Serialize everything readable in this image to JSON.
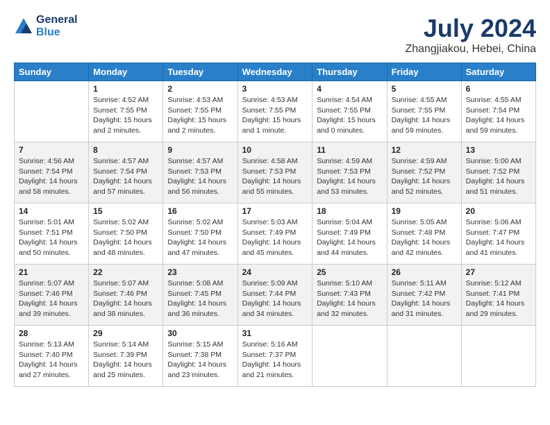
{
  "header": {
    "logo_line1": "General",
    "logo_line2": "Blue",
    "title": "July 2024",
    "subtitle": "Zhangjiakou, Hebei, China"
  },
  "days_of_week": [
    "Sunday",
    "Monday",
    "Tuesday",
    "Wednesday",
    "Thursday",
    "Friday",
    "Saturday"
  ],
  "weeks": [
    [
      {
        "day": "",
        "info": ""
      },
      {
        "day": "1",
        "info": "Sunrise: 4:52 AM\nSunset: 7:55 PM\nDaylight: 15 hours\nand 2 minutes."
      },
      {
        "day": "2",
        "info": "Sunrise: 4:53 AM\nSunset: 7:55 PM\nDaylight: 15 hours\nand 2 minutes."
      },
      {
        "day": "3",
        "info": "Sunrise: 4:53 AM\nSunset: 7:55 PM\nDaylight: 15 hours\nand 1 minute."
      },
      {
        "day": "4",
        "info": "Sunrise: 4:54 AM\nSunset: 7:55 PM\nDaylight: 15 hours\nand 0 minutes."
      },
      {
        "day": "5",
        "info": "Sunrise: 4:55 AM\nSunset: 7:55 PM\nDaylight: 14 hours\nand 59 minutes."
      },
      {
        "day": "6",
        "info": "Sunrise: 4:55 AM\nSunset: 7:54 PM\nDaylight: 14 hours\nand 59 minutes."
      }
    ],
    [
      {
        "day": "7",
        "info": "Sunrise: 4:56 AM\nSunset: 7:54 PM\nDaylight: 14 hours\nand 58 minutes."
      },
      {
        "day": "8",
        "info": "Sunrise: 4:57 AM\nSunset: 7:54 PM\nDaylight: 14 hours\nand 57 minutes."
      },
      {
        "day": "9",
        "info": "Sunrise: 4:57 AM\nSunset: 7:53 PM\nDaylight: 14 hours\nand 56 minutes."
      },
      {
        "day": "10",
        "info": "Sunrise: 4:58 AM\nSunset: 7:53 PM\nDaylight: 14 hours\nand 55 minutes."
      },
      {
        "day": "11",
        "info": "Sunrise: 4:59 AM\nSunset: 7:53 PM\nDaylight: 14 hours\nand 53 minutes."
      },
      {
        "day": "12",
        "info": "Sunrise: 4:59 AM\nSunset: 7:52 PM\nDaylight: 14 hours\nand 52 minutes."
      },
      {
        "day": "13",
        "info": "Sunrise: 5:00 AM\nSunset: 7:52 PM\nDaylight: 14 hours\nand 51 minutes."
      }
    ],
    [
      {
        "day": "14",
        "info": "Sunrise: 5:01 AM\nSunset: 7:51 PM\nDaylight: 14 hours\nand 50 minutes."
      },
      {
        "day": "15",
        "info": "Sunrise: 5:02 AM\nSunset: 7:50 PM\nDaylight: 14 hours\nand 48 minutes."
      },
      {
        "day": "16",
        "info": "Sunrise: 5:02 AM\nSunset: 7:50 PM\nDaylight: 14 hours\nand 47 minutes."
      },
      {
        "day": "17",
        "info": "Sunrise: 5:03 AM\nSunset: 7:49 PM\nDaylight: 14 hours\nand 45 minutes."
      },
      {
        "day": "18",
        "info": "Sunrise: 5:04 AM\nSunset: 7:49 PM\nDaylight: 14 hours\nand 44 minutes."
      },
      {
        "day": "19",
        "info": "Sunrise: 5:05 AM\nSunset: 7:48 PM\nDaylight: 14 hours\nand 42 minutes."
      },
      {
        "day": "20",
        "info": "Sunrise: 5:06 AM\nSunset: 7:47 PM\nDaylight: 14 hours\nand 41 minutes."
      }
    ],
    [
      {
        "day": "21",
        "info": "Sunrise: 5:07 AM\nSunset: 7:46 PM\nDaylight: 14 hours\nand 39 minutes."
      },
      {
        "day": "22",
        "info": "Sunrise: 5:07 AM\nSunset: 7:46 PM\nDaylight: 14 hours\nand 38 minutes."
      },
      {
        "day": "23",
        "info": "Sunrise: 5:08 AM\nSunset: 7:45 PM\nDaylight: 14 hours\nand 36 minutes."
      },
      {
        "day": "24",
        "info": "Sunrise: 5:09 AM\nSunset: 7:44 PM\nDaylight: 14 hours\nand 34 minutes."
      },
      {
        "day": "25",
        "info": "Sunrise: 5:10 AM\nSunset: 7:43 PM\nDaylight: 14 hours\nand 32 minutes."
      },
      {
        "day": "26",
        "info": "Sunrise: 5:11 AM\nSunset: 7:42 PM\nDaylight: 14 hours\nand 31 minutes."
      },
      {
        "day": "27",
        "info": "Sunrise: 5:12 AM\nSunset: 7:41 PM\nDaylight: 14 hours\nand 29 minutes."
      }
    ],
    [
      {
        "day": "28",
        "info": "Sunrise: 5:13 AM\nSunset: 7:40 PM\nDaylight: 14 hours\nand 27 minutes."
      },
      {
        "day": "29",
        "info": "Sunrise: 5:14 AM\nSunset: 7:39 PM\nDaylight: 14 hours\nand 25 minutes."
      },
      {
        "day": "30",
        "info": "Sunrise: 5:15 AM\nSunset: 7:38 PM\nDaylight: 14 hours\nand 23 minutes."
      },
      {
        "day": "31",
        "info": "Sunrise: 5:16 AM\nSunset: 7:37 PM\nDaylight: 14 hours\nand 21 minutes."
      },
      {
        "day": "",
        "info": ""
      },
      {
        "day": "",
        "info": ""
      },
      {
        "day": "",
        "info": ""
      }
    ]
  ]
}
